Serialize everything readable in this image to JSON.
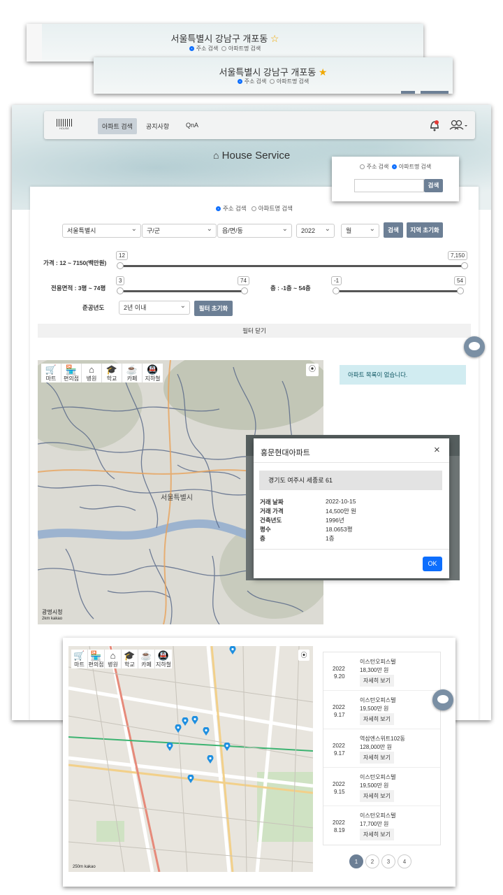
{
  "shot1": {
    "title": "서울특별시 강남구 개포동",
    "star": "☆",
    "radio_address": "주소 검색",
    "radio_apt": "아파트명 검색"
  },
  "shot2": {
    "title": "서울특별시 강남구 개포동",
    "star": "★",
    "radio_address": "주소 검색",
    "radio_apt": "아파트명 검색"
  },
  "nav": {
    "logo_text": "HOUSE",
    "items": [
      "아파트 검색",
      "공지사항",
      "QnA"
    ]
  },
  "brand": {
    "title": "House Service"
  },
  "search_popup": {
    "radio_address": "주소 검색",
    "radio_apt": "아파트명 검색",
    "button": "검색",
    "input_value": ""
  },
  "filter": {
    "radio_address": "주소 검색",
    "radio_apt": "아파트명 검색",
    "sido": "서울특별시",
    "gugun": "구/군",
    "dong": "읍/면/동",
    "year": "2022",
    "month": "월",
    "search_btn": "검색",
    "reset_region_btn": "지역 초기화",
    "price_label": "가격 : 12 ~ 7150(백만원)",
    "price_min": "12",
    "price_max": "7,150",
    "area_label": "전용면적 : 3평 ~ 74평",
    "area_min": "3",
    "area_max": "74",
    "floor_label": "층 : -1층 ~ 54층",
    "floor_min": "-1",
    "floor_max": "54",
    "built_label": "준공년도",
    "built_value": "2년 이내",
    "reset_filter_btn": "필터 초기화",
    "close_filter": "필터 닫기"
  },
  "map_icons": [
    {
      "label": "마트",
      "icon": "cart-icon",
      "glyph": "🛒"
    },
    {
      "label": "편의점",
      "icon": "store-icon",
      "glyph": "🏪"
    },
    {
      "label": "병원",
      "icon": "hospital-icon",
      "glyph": "⌂"
    },
    {
      "label": "학교",
      "icon": "school-icon",
      "glyph": "🎓"
    },
    {
      "label": "카페",
      "icon": "cafe-icon",
      "glyph": "☕"
    },
    {
      "label": "지하철",
      "icon": "subway-icon",
      "glyph": "🚇"
    }
  ],
  "map1": {
    "city_label": "서울특별시",
    "corner_label": "광명시청",
    "scale": "2km",
    "kakao": "kakao"
  },
  "no_apts": "아파트 목록이 없습니다.",
  "modal": {
    "title": "홍문현대아파트",
    "close": "×",
    "address": "경기도 여주시 세종로 61",
    "rows": [
      {
        "k": "거래 날짜",
        "v": "2022-10-15"
      },
      {
        "k": "거래 가격",
        "v": "14,500만 원"
      },
      {
        "k": "건축년도",
        "v": "1996년"
      },
      {
        "k": "평수",
        "v": "18.0653평"
      },
      {
        "k": "층",
        "v": "1층"
      }
    ],
    "ok": "OK"
  },
  "map2": {
    "scale": "250m",
    "kakao": "kakao"
  },
  "deals": [
    {
      "year": "2022",
      "date": "9.20",
      "name": "이스턴오피스텔",
      "price": "18,300만 원",
      "btn": "자세히 보기"
    },
    {
      "year": "2022",
      "date": "9.17",
      "name": "이스턴오피스텔",
      "price": "19,500만 원",
      "btn": "자세히 보기"
    },
    {
      "year": "2022",
      "date": "9.17",
      "name": "역삼엔스위트102동",
      "price": "128,000만 원",
      "btn": "자세히 보기"
    },
    {
      "year": "2022",
      "date": "9.15",
      "name": "이스턴오피스텔",
      "price": "19,500만 원",
      "btn": "자세히 보기"
    },
    {
      "year": "2022",
      "date": "8.19",
      "name": "이스턴오피스텔",
      "price": "17,700만 원",
      "btn": "자세히 보기"
    }
  ],
  "pages": [
    "1",
    "2",
    "3",
    "4"
  ],
  "colors": {
    "accent": "#6c7f95",
    "primary": "#0d6efd",
    "alert_bg": "#d1ecf1",
    "pin": "#1e8fe0"
  }
}
